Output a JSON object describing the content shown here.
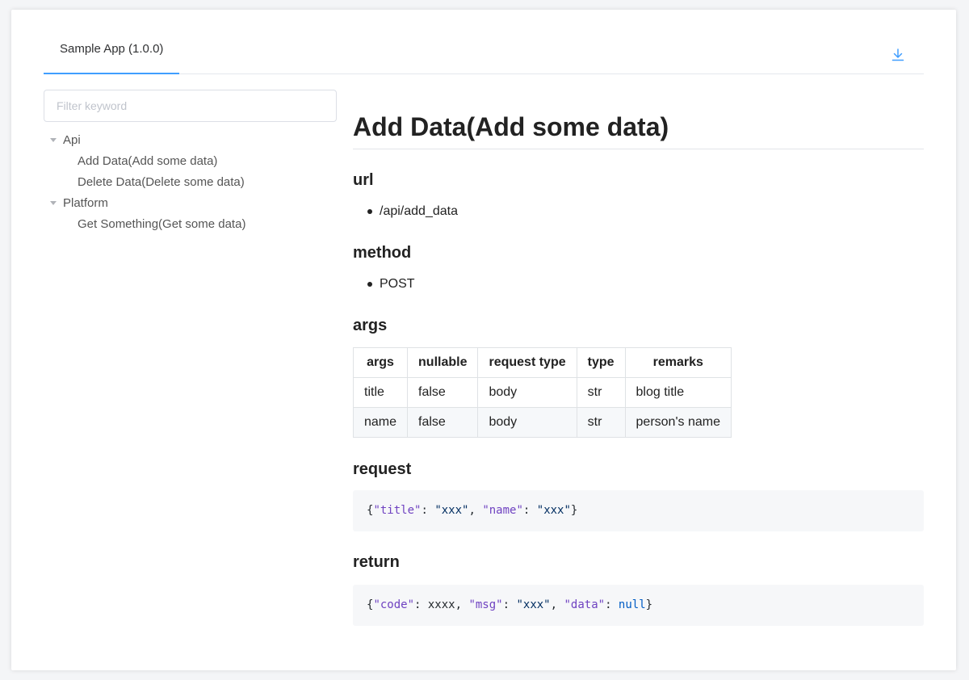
{
  "tab": {
    "label": "Sample App (1.0.0)"
  },
  "download_icon": "download-icon",
  "accent_color": "#409eff",
  "sidebar": {
    "filter_placeholder": "Filter keyword",
    "tree": [
      {
        "label": "Api",
        "children": [
          "Add Data(Add some data)",
          "Delete Data(Delete some data)"
        ]
      },
      {
        "label": "Platform",
        "children": [
          "Get Something(Get some data)"
        ]
      }
    ]
  },
  "doc": {
    "title": "Add Data(Add some data)",
    "url_heading": "url",
    "url_value": "/api/add_data",
    "method_heading": "method",
    "method_value": "POST",
    "args_heading": "args",
    "args_table": {
      "headers": [
        "args",
        "nullable",
        "request type",
        "type",
        "remarks"
      ],
      "rows": [
        [
          "title",
          "false",
          "body",
          "str",
          "blog title"
        ],
        [
          "name",
          "false",
          "body",
          "str",
          "person's name"
        ]
      ]
    },
    "request_heading": "request",
    "request_tokens": [
      {
        "t": "{",
        "c": "p"
      },
      {
        "t": "\"title\"",
        "c": "k"
      },
      {
        "t": ": ",
        "c": "p"
      },
      {
        "t": "\"xxx\"",
        "c": "s"
      },
      {
        "t": ", ",
        "c": "p"
      },
      {
        "t": "\"name\"",
        "c": "k"
      },
      {
        "t": ": ",
        "c": "p"
      },
      {
        "t": "\"xxx\"",
        "c": "s"
      },
      {
        "t": "}",
        "c": "p"
      }
    ],
    "return_heading": "return",
    "return_tokens": [
      {
        "t": "{",
        "c": "p"
      },
      {
        "t": "\"code\"",
        "c": "k"
      },
      {
        "t": ": xxxx, ",
        "c": "p"
      },
      {
        "t": "\"msg\"",
        "c": "k"
      },
      {
        "t": ": ",
        "c": "p"
      },
      {
        "t": "\"xxx\"",
        "c": "s"
      },
      {
        "t": ", ",
        "c": "p"
      },
      {
        "t": "\"data\"",
        "c": "k"
      },
      {
        "t": ": ",
        "c": "p"
      },
      {
        "t": "null",
        "c": "n"
      },
      {
        "t": "}",
        "c": "p"
      }
    ]
  }
}
